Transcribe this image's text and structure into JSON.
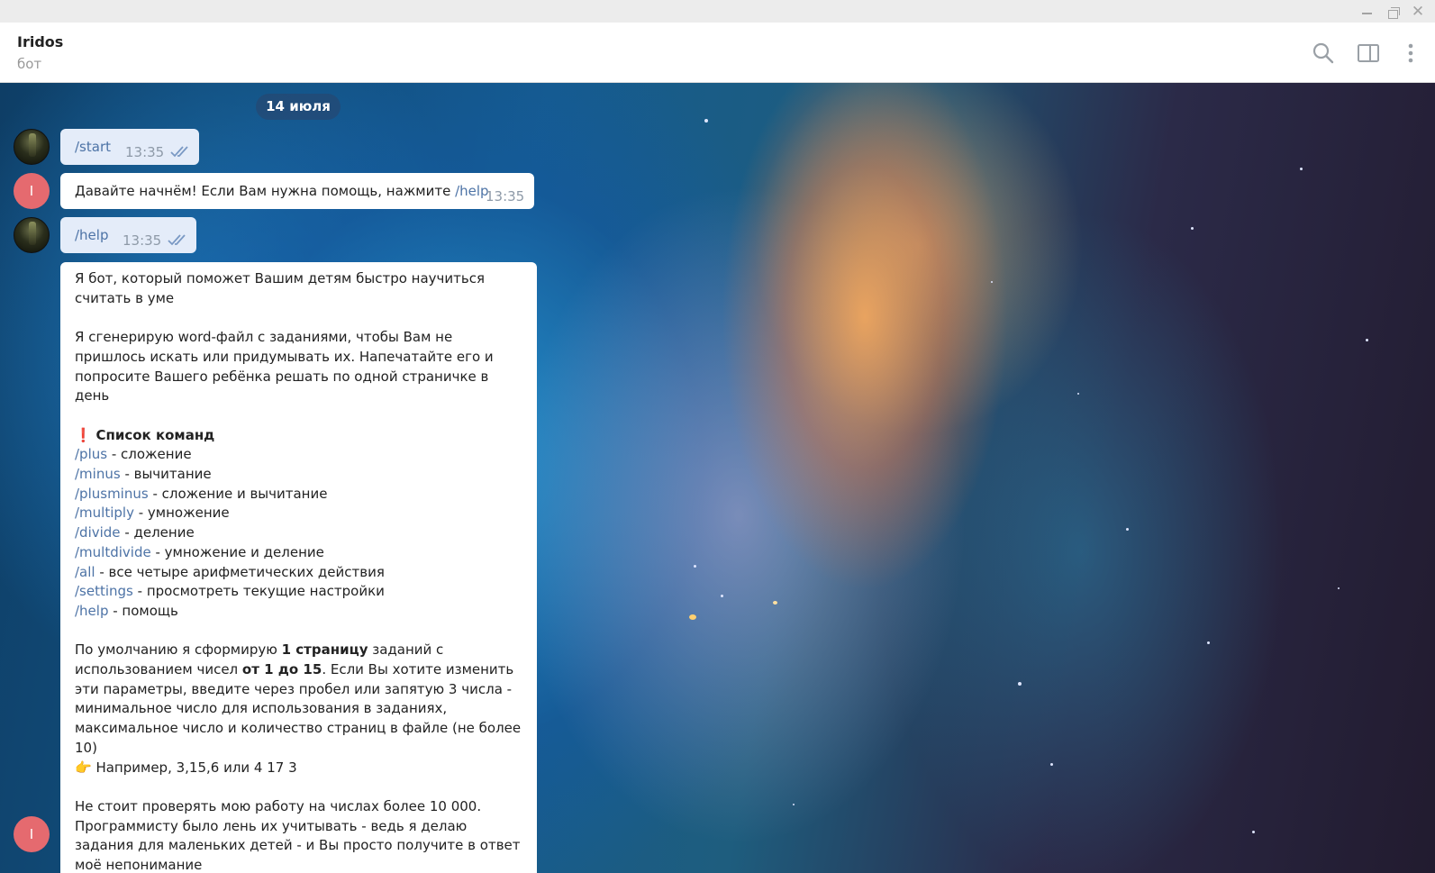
{
  "window": {
    "controls": {
      "minimize": "minimize-icon",
      "maximize": "restore-icon",
      "close": "close-icon"
    }
  },
  "header": {
    "title": "Iridos",
    "subtitle": "бот",
    "icons": [
      "search-icon",
      "sidebar-toggle-icon",
      "more-vert-icon"
    ]
  },
  "chat": {
    "date_separator": "14 июля",
    "messages": [
      {
        "from": "user",
        "text": "/start",
        "time": "13:35",
        "status": "read"
      },
      {
        "from": "bot",
        "text_before": "Давайте начнём! Если Вам нужна помощь, нажмите ",
        "link": "/help",
        "time": "13:35"
      },
      {
        "from": "user",
        "text": "/help",
        "time": "13:35",
        "status": "read"
      }
    ],
    "bot_avatar_letter": "I",
    "help_message": {
      "intro_1": "Я бот, который поможет Вашим детям быстро научиться считать в уме",
      "intro_2": "Я сгенерирую word-файл с заданиями, чтобы Вам не пришлось искать или придумывать их. Напечатайте его и попросите Вашего ребёнка решать по одной страничке в день",
      "commands_title_icon": "❗",
      "commands_title": "Список команд",
      "commands": [
        {
          "cmd": "/plus",
          "desc": " - сложение"
        },
        {
          "cmd": "/minus",
          "desc": " - вычитание"
        },
        {
          "cmd": "/plusminus",
          "desc": " - сложение и вычитание"
        },
        {
          "cmd": "/multiply",
          "desc": " - умножение"
        },
        {
          "cmd": "/divide",
          "desc": " - деление"
        },
        {
          "cmd": "/multdivide",
          "desc": " - умножение и деление"
        },
        {
          "cmd": "/all",
          "desc": " - все четыре арифметических действия"
        },
        {
          "cmd": "/settings",
          "desc": " - просмотреть текущие настройки"
        },
        {
          "cmd": "/help",
          "desc": " - помощь"
        }
      ],
      "defaults_p1": "По умолчанию я сформирую ",
      "defaults_b1": "1 страницу",
      "defaults_p2": " заданий с использованием чисел ",
      "defaults_b2": "от 1 до 15",
      "defaults_p3": ". Если Вы хотите изменить эти параметры, введите через пробел или запятую 3 числа - минимальное число для использования в заданиях, максимальное число и количество страниц в файле (не более 10)",
      "example_icon": "👉",
      "example": " Например, 3,15,6 или 4 17 3",
      "warning": "Не стоит проверять мою работу на числах более 10 000. Программисту было лень их учитывать - ведь я делаю задания для маленьких детей - и Вы просто получите в ответ моё непонимание"
    }
  }
}
